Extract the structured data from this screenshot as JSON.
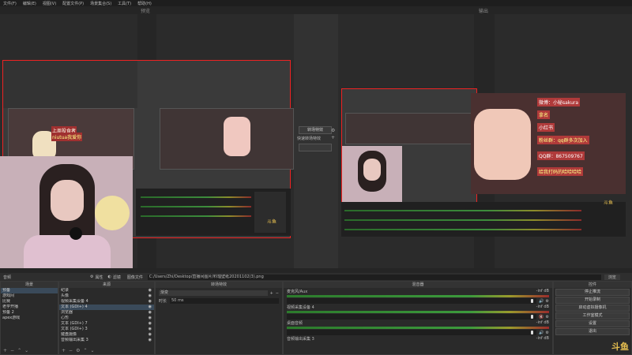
{
  "menu": [
    "文件(F)",
    "编辑(E)",
    "视图(V)",
    "配置文件(P)",
    "场景集合(S)",
    "工具(T)",
    "帮助(H)"
  ],
  "preview_label": "预览",
  "program_label": "输出",
  "transition": {
    "button_label": "转场特效",
    "quick_label": "快速转场特效"
  },
  "toolbar": {
    "audio_label": "音频",
    "properties_label": "属性",
    "filters_label": "滤镜",
    "image_file_label": "图像文件",
    "path_value": "C:/Users/Zhi/Desktop/直播间图片/料理壁纸20201102(3).png",
    "browse_label": "浏览"
  },
  "scenes": {
    "title": "场景",
    "items": [
      "预备",
      "游戏间",
      "比赛",
      "老学开播",
      "预备 2",
      "apex游戏"
    ]
  },
  "sources": {
    "title": "来源",
    "items": [
      "纪录",
      "头像",
      "视频采集设备 4",
      "文本 (GDI+) 4",
      "浏览器",
      "心形",
      "文本 (GDI+) 7",
      "文本 (GDI+) 3",
      "键盘摄像",
      "音频输出采集 3"
    ]
  },
  "transitions_dock": {
    "title": "转场特效",
    "type_value": "渐变",
    "duration_label": "时长",
    "duration_value": "50 ms"
  },
  "mixer": {
    "title": "混音器",
    "channels": [
      {
        "name": "麦克风/Aux",
        "db": "-inf dB"
      },
      {
        "name": "视频采集设备 4",
        "db": "-inf dB"
      },
      {
        "name": "桌面音频",
        "db": "-inf dB"
      },
      {
        "name": "音频输出采集 3",
        "db": "-inf dB"
      }
    ]
  },
  "controls": {
    "title": "控件",
    "buttons": [
      "停止推流",
      "开始录制",
      "启动虚拟摄像机",
      "工作室模式",
      "设置",
      "退出"
    ]
  },
  "watermark": "斗鱼",
  "overlay": {
    "left_sign": "上周投食者",
    "left_name": "niutua我爱你",
    "right_lines": [
      "微博：小秘sakura",
      "拿名",
      "小红书",
      "粉丝群：qq群多次加入",
      "QQ群：867509767",
      "给我打码的哈哈哈哈"
    ]
  },
  "colors": {
    "selection_red": "#e22222",
    "accent_green": "#3c9a3c"
  }
}
